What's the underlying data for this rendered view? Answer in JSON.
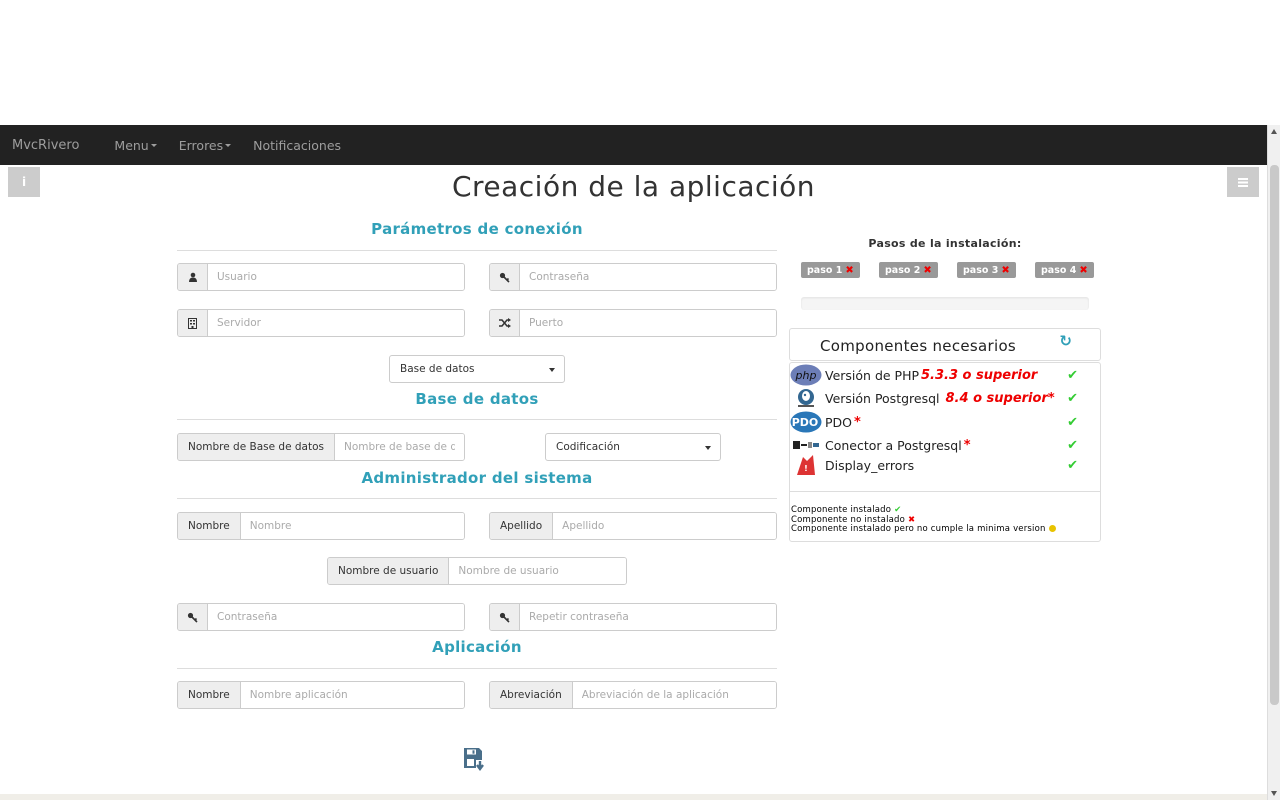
{
  "navbar": {
    "brand": "MvcRivero",
    "items": [
      {
        "label": "Menu",
        "dropdown": true
      },
      {
        "label": "Errores",
        "dropdown": true
      },
      {
        "label": "Notificaciones",
        "dropdown": false
      }
    ]
  },
  "side_buttons": {
    "left_icon": "info-icon",
    "right_icon": "hamburger-menu-icon"
  },
  "page_title": "Creación de la aplicación",
  "sections": {
    "conexion": "Parámetros de conexión",
    "base_datos": "Base de datos",
    "admin": "Administrador del sistema",
    "aplicacion": "Aplicación"
  },
  "fields": {
    "usuario": {
      "placeholder": "Usuario",
      "icon": "user-icon"
    },
    "password": {
      "placeholder": "Contraseña",
      "icon": "key-icon"
    },
    "servidor": {
      "placeholder": "Servidor",
      "icon": "building-icon"
    },
    "puerto": {
      "placeholder": "Puerto",
      "icon": "random-icon"
    },
    "db_select": "Base de datos",
    "db_name": {
      "label": "Nombre de Base de datos",
      "placeholder": "Nombre de base de da"
    },
    "codificacion": "Codificación",
    "admin_nombre": {
      "label": "Nombre",
      "placeholder": "Nombre"
    },
    "admin_apellido": {
      "label": "Apellido",
      "placeholder": "Apellido"
    },
    "admin_username": {
      "label": "Nombre de usuario",
      "placeholder": "Nombre de usuario"
    },
    "admin_password": {
      "placeholder": "Contraseña",
      "icon": "key-icon"
    },
    "admin_password2": {
      "placeholder": "Repetir contraseña",
      "icon": "key-icon"
    },
    "app_nombre": {
      "label": "Nombre",
      "placeholder": "Nombre aplicación"
    },
    "app_abrev": {
      "label": "Abreviación",
      "placeholder": "Abreviación de la aplicación"
    }
  },
  "steps": {
    "label": "Pasos de la instalación:",
    "items": [
      "paso 1",
      "paso 2",
      "paso 3",
      "paso 4"
    ],
    "status_icon": "x-icon"
  },
  "progress": 0,
  "components": {
    "title": "Componentes necesarios",
    "refresh_icon": "refresh-icon",
    "items": [
      {
        "name": "Versión de PHP",
        "req": "5.3.3 o superior",
        "logo": "php-logo-icon",
        "status": "installed"
      },
      {
        "name": "Versión Postgresql",
        "req": "8.4 o superior*",
        "logo": "postgresql-logo-icon",
        "status": "installed"
      },
      {
        "name": "PDO",
        "req": "*",
        "logo": "pdo-logo-icon",
        "status": "installed"
      },
      {
        "name": "Conector a Postgresql",
        "req": "*",
        "logo": "connector-logo-icon",
        "status": "installed"
      },
      {
        "name": "Display_errors",
        "req": "",
        "logo": "display-errors-logo-icon",
        "status": "installed"
      }
    ],
    "legend": {
      "installed": "Componente instalado",
      "not_installed": "Componente no instalado",
      "warning": "Componente instalado pero no cumple la minima version"
    }
  },
  "save_icon": "save-icon",
  "colors": {
    "accent": "#31a0b8",
    "navbar": "#222222",
    "ok": "#33cc33",
    "error": "#ee0000"
  }
}
